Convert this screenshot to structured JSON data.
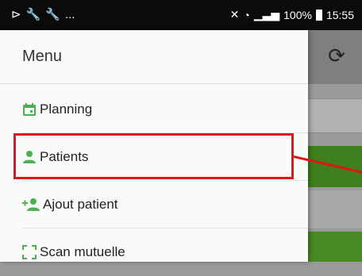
{
  "status_bar": {
    "left_icons": [
      "mail-plane-icon",
      "wrench-icon",
      "wrench-icon"
    ],
    "overflow": "...",
    "right_icons": [
      "mute-icon",
      "wifi-icon",
      "signal-icon"
    ],
    "battery": "100%",
    "time": "15:55"
  },
  "drawer": {
    "title": "Menu",
    "items": [
      {
        "label": "Planning",
        "icon": "calendar-icon"
      },
      {
        "label": "Patients",
        "icon": "person-icon"
      },
      {
        "label": "Ajout patient",
        "icon": "add-person-icon"
      },
      {
        "label": "Scan mutuelle",
        "icon": "scan-icon"
      }
    ]
  },
  "app": {
    "refresh_icon": "refresh-icon"
  },
  "colors": {
    "accent_green": "#4caf50",
    "highlight_red": "#e01515"
  }
}
